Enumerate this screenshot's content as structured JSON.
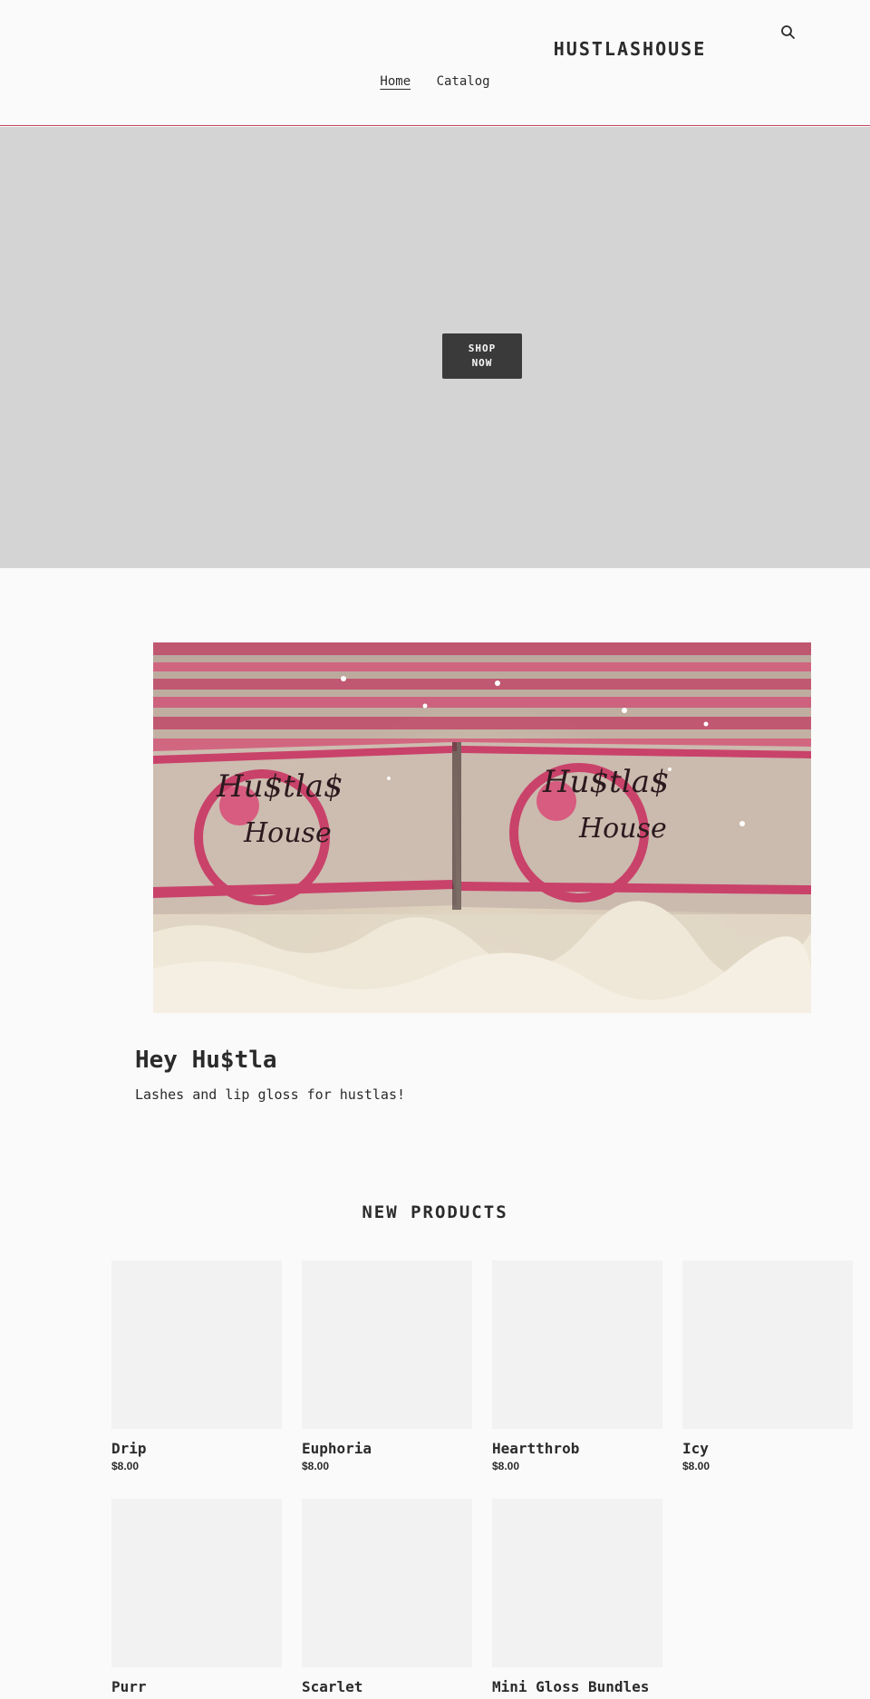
{
  "header": {
    "logo": "HUSTLASHOUSE",
    "search_icon": "search-icon",
    "nav": [
      {
        "label": "Home",
        "active": true
      },
      {
        "label": "Catalog",
        "active": false
      }
    ],
    "divider_color": "#c7465f"
  },
  "hero": {
    "button_label": "SHOP NOW",
    "background_color": "#d4d4d4"
  },
  "feature": {
    "title": "Hey Hu$tla",
    "text": "Lashes and lip gloss for hustlas!",
    "image_lettering": "Hu$tla$ House"
  },
  "new_products": {
    "title": "NEW PRODUCTS",
    "items": [
      {
        "name": "Drip",
        "price": "$8.00"
      },
      {
        "name": "Euphoria",
        "price": "$8.00"
      },
      {
        "name": "Heartthrob",
        "price": "$8.00"
      },
      {
        "name": "Icy",
        "price": "$8.00"
      },
      {
        "name": "Purr"
      },
      {
        "name": "Scarlet"
      },
      {
        "name": "Mini Gloss Bundles"
      }
    ]
  },
  "colors": {
    "accent": "#c7465f",
    "text": "#2b2b2b",
    "background": "#fafafa",
    "button": "#3a3a3a"
  }
}
